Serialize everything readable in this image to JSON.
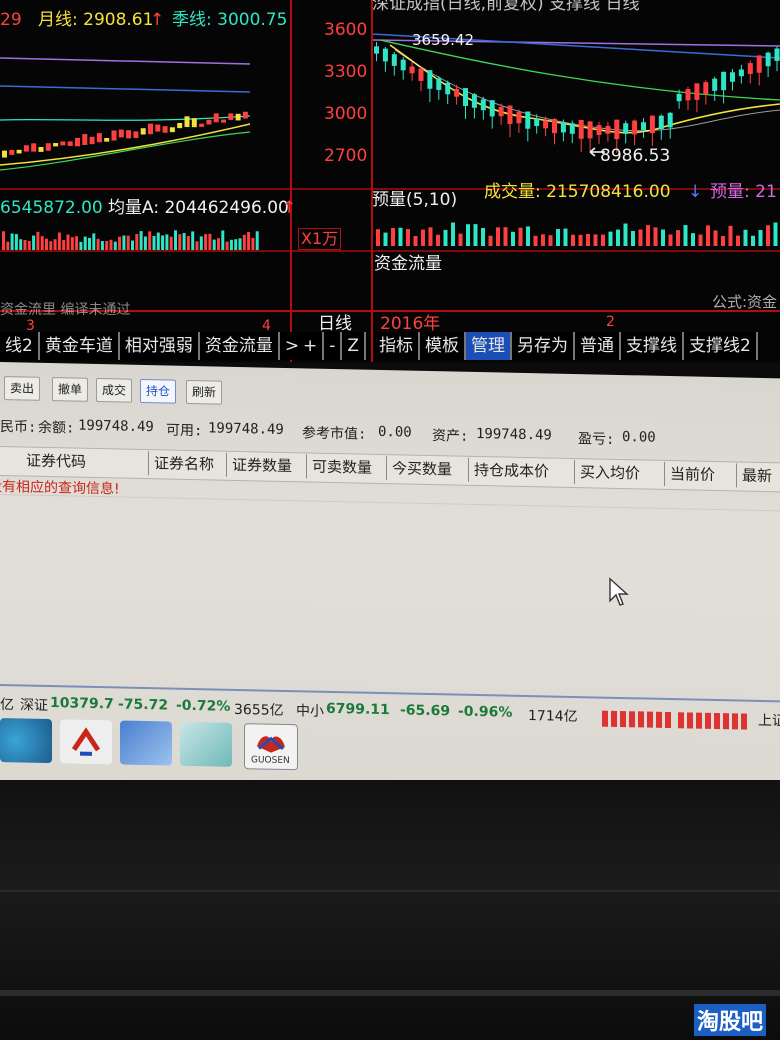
{
  "chart_left": {
    "ma_labels": [
      "29",
      "月线: 2908.61",
      "季线: 3000.75"
    ],
    "volume_labels": [
      "6545872.00",
      "均量A: 204462496.00"
    ],
    "panel_number": "3",
    "panel_number2": "4",
    "partial_text": "资金流里  编译未通过"
  },
  "chart_right": {
    "title": "深证成指(日线,前复权) 支撑线  日线",
    "y_ticks": [
      "3600",
      "3300",
      "3000",
      "2700"
    ],
    "high_label": "3659.42",
    "low_label": "8986.53",
    "volume_header": [
      "预量(5,10)",
      "成交量: 215708416.00",
      "预量: 21"
    ],
    "unit_label": "X1万",
    "money_flow": "资金流量",
    "formula_partial": "公式:资金",
    "period_label": "日线",
    "year_label": "2016年",
    "marker": "2"
  },
  "tabs_left": [
    "线2",
    "黄金车道",
    "相对强弱",
    "资金流量",
    ">"
  ],
  "tabs_middle": [
    "+",
    "-",
    "Z"
  ],
  "tabs_right": [
    "指标",
    "模板",
    "管理",
    "另存为",
    "普通",
    "支撑线",
    "支撑线2"
  ],
  "toolbar": [
    "卖出",
    "撤单",
    "成交",
    "持仓",
    "刷新"
  ],
  "account": {
    "currency": "民币:",
    "balance_label": "余额:",
    "balance": "199748.49",
    "available_label": "可用:",
    "available": "199748.49",
    "market_value_label": "参考市值:",
    "market_value": "0.00",
    "assets_label": "资产:",
    "assets": "199748.49",
    "pnl_label": "盈亏:",
    "pnl": "0.00"
  },
  "table": {
    "columns": [
      "证券代码",
      "证券名称",
      "证券数量",
      "可卖数量",
      "今买数量",
      "持仓成本价",
      "买入均价",
      "当前价",
      "最新"
    ],
    "empty_message": "没有相应的查询信息!"
  },
  "status_bar": {
    "prefix": "亿",
    "sz_label": "深证",
    "sz_value": "10379.7",
    "sz_change": "-75.72",
    "sz_pct": "-0.72%",
    "sz_amount": "3655亿",
    "zx_label": "中小",
    "zx_value": "6799.11",
    "zx_change": "-65.69",
    "zx_pct": "-0.96%",
    "zx_amount": "1714亿",
    "right_text": "上证"
  },
  "taskbar": {
    "app_label": "GUOSEN"
  },
  "watermark": "淘股吧",
  "colors": {
    "up": "#ff4040",
    "down": "#2ee6c6",
    "ma_yellow": "#f4e23a",
    "link_blue": "#1c56c9"
  }
}
